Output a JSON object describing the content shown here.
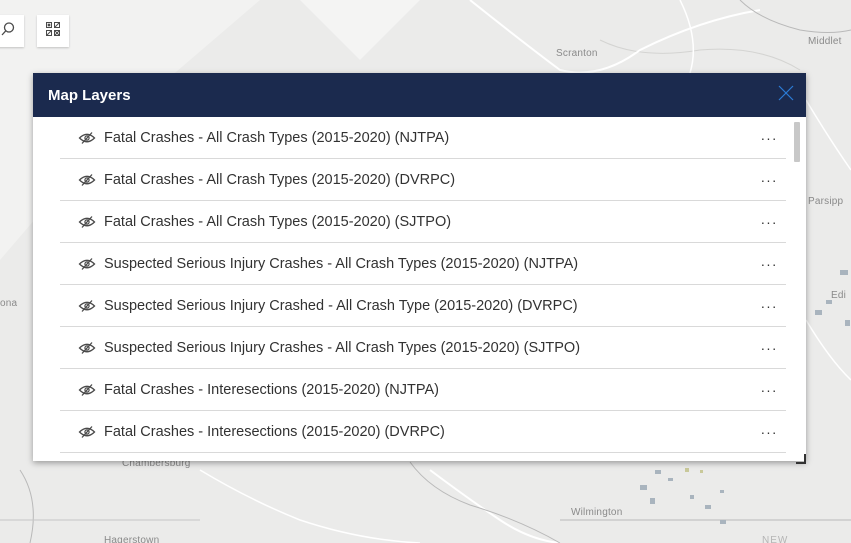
{
  "map": {
    "labels": {
      "scranton": "Scranton",
      "middletown": "Middlet",
      "parsippany": "Parsipp",
      "edison": "Edi",
      "ona": "ona",
      "wilmington": "Wilmington",
      "hagerstown": "Hagerstown",
      "chambersburg": "Chambersburg",
      "newjersey": "NEW"
    },
    "colors": {
      "background": "#ebebea",
      "roads": "#ffffff",
      "boundaries": "#b9b9b9",
      "urban": "#a9b4be"
    }
  },
  "tools": {
    "search_icon": "search-icon",
    "layers_icon": "qr-grid-icon"
  },
  "panel": {
    "title": "Map Layers",
    "close_icon": "close-icon",
    "header_color": "#1b2a4e",
    "layers": [
      {
        "label": "Fatal Crashes - All Crash Types (2015-2020) (NJTPA)",
        "visible": false
      },
      {
        "label": "Fatal Crashes - All Crash Types (2015-2020) (DVRPC)",
        "visible": false
      },
      {
        "label": "Fatal Crashes - All Crash Types (2015-2020) (SJTPO)",
        "visible": false
      },
      {
        "label": "Suspected Serious Injury Crashes - All Crash Types (2015-2020) (NJTPA)",
        "visible": false
      },
      {
        "label": "Suspected Serious Injury Crashed - All Crash Type (2015-2020) (DVRPC)",
        "visible": false
      },
      {
        "label": "Suspected Serious Injury Crashes - All Crash Types (2015-2020) (SJTPO)",
        "visible": false
      },
      {
        "label": "Fatal Crashes - Interesections (2015-2020) (NJTPA)",
        "visible": false
      },
      {
        "label": "Fatal Crashes - Interesections (2015-2020) (DVRPC)",
        "visible": false
      }
    ],
    "more_label": "···"
  }
}
